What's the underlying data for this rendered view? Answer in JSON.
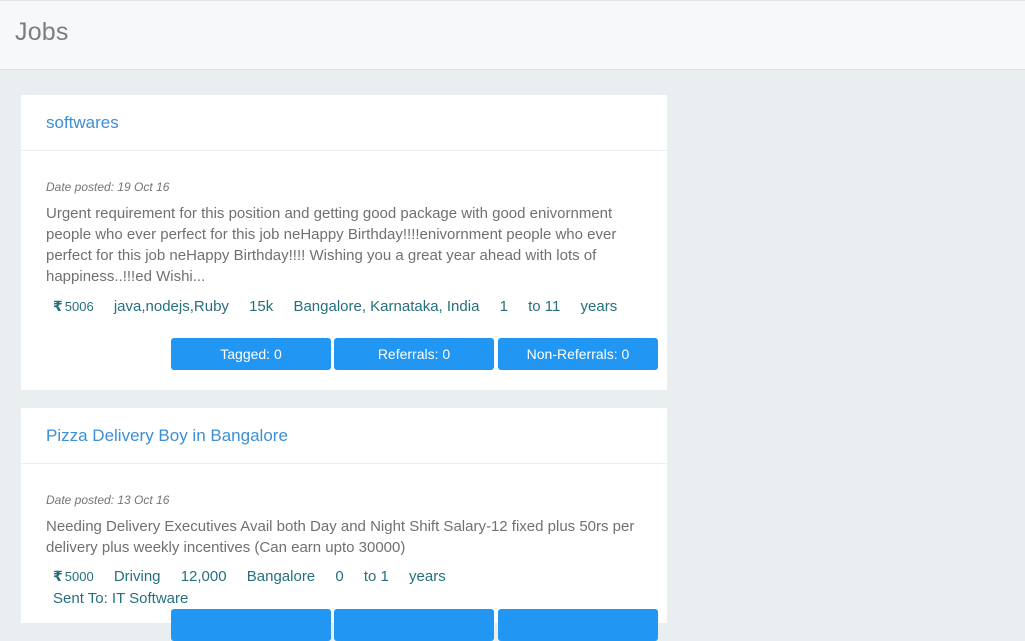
{
  "header": {
    "title": "Jobs"
  },
  "jobs": [
    {
      "title": "softwares",
      "date_posted": "Date posted: 19 Oct 16",
      "description": "Urgent requirement for this position and getting good package with good enivornment people who ever perfect for this job neHappy Birthday!!!!enivornment people who ever perfect for this job neHappy Birthday!!!! Wishing you a great year ahead with lots of happiness..!!!ed Wishi...",
      "rupee_icon": "₹",
      "salary": "5006",
      "skills": "java,nodejs,Ruby",
      "package": "15k",
      "location": "Bangalore, Karnataka, India",
      "exp_from": "1",
      "exp_to": "to 11",
      "exp_unit": "years",
      "tagged": "Tagged: 0",
      "referrals": "Referrals: 0",
      "non_referrals": "Non-Referrals: 0"
    },
    {
      "title": "Pizza Delivery Boy in Bangalore",
      "date_posted": "Date posted: 13 Oct 16",
      "description": "Needing Delivery Executives Avail both Day and Night Shift Salary-12 fixed plus 50rs per delivery plus weekly incentives (Can earn upto 30000)",
      "rupee_icon": "₹",
      "salary": "5000",
      "skills": "Driving",
      "package": "12,000",
      "location": "Bangalore",
      "exp_from": "0",
      "exp_to": "to 1",
      "exp_unit": "years",
      "sent_to": "Sent To: IT Software"
    }
  ],
  "colors": {
    "accent": "#2196f3",
    "title_link": "#3d8fd6",
    "meta_text": "#256f7d",
    "background": "#e9eef0"
  }
}
